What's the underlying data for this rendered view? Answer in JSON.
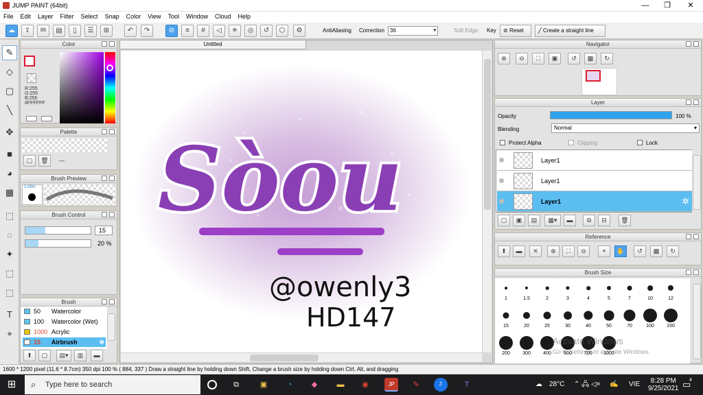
{
  "window": {
    "title": "JUMP PAINT (64bit)",
    "minimize": "—",
    "restore": "❐",
    "close": "✕"
  },
  "menu": [
    "File",
    "Edit",
    "Layer",
    "Filter",
    "Select",
    "Snap",
    "Color",
    "View",
    "Tool",
    "Window",
    "Cloud",
    "Help"
  ],
  "toolbar": {
    "antialiasing_label": "AntiAliasing",
    "correction_label": "Correction",
    "correction_value": "36",
    "softedge_label": "Soft Edge",
    "key_label": "Key",
    "reset_label": "Reset",
    "straight_line_label": "Create a straight line"
  },
  "color_panel": {
    "title": "Color",
    "r": "R:255",
    "g": "G:255",
    "b": "B:255",
    "hex": "#FFFFFF"
  },
  "palette_panel": {
    "title": "Palette",
    "count": "---"
  },
  "brush_preview": {
    "title": "Brush Preview",
    "size": "1.09m"
  },
  "brush_control": {
    "title": "Brush Control",
    "size_value": "15",
    "opacity_value": "20 %",
    "size_fraction": 0.3,
    "opacity_fraction": 0.2
  },
  "brush_panel": {
    "title": "Brush",
    "items": [
      {
        "size": "50",
        "name": "Watercolor",
        "color": "#5bc6ee"
      },
      {
        "size": "100",
        "name": "Watercolor (Wet)",
        "color": "#5bc6ee"
      },
      {
        "size": "1000",
        "name": "Acrylic",
        "color": "#e6c800"
      },
      {
        "size": "15",
        "name": "Airbrush",
        "color": "#f6f6f6"
      }
    ]
  },
  "canvas": {
    "tab_title": "Untitled",
    "artwork_text": "Sòou",
    "handwriting_1": "@owenly3",
    "handwriting_2": "HD147"
  },
  "statusbar": {
    "text": "1600 * 1200 pixel  (11.6 * 8.7cm)  350 dpi  100 %  ( 884, 337 )  Draw a straight line by holding down Shift, Change a brush size by holding down Ctrl, Alt, and dragging"
  },
  "navigator": {
    "title": "Navigator"
  },
  "layer_panel": {
    "title": "Layer",
    "opacity_label": "Opacity",
    "opacity_value": "100 %",
    "opacity_fraction": 1.0,
    "blending_label": "Blending",
    "blending_value": "Normal",
    "protect_alpha": "Protect Alpha",
    "clipping": "Clipping",
    "lock": "Lock",
    "layers": [
      "Layer1",
      "Layer1",
      "Layer1"
    ]
  },
  "reference": {
    "title": "Reference"
  },
  "brush_size": {
    "title": "Brush Size",
    "sizes": [
      "1",
      "1.5",
      "2",
      "3",
      "4",
      "5",
      "7",
      "10",
      "12",
      "15",
      "20",
      "25",
      "30",
      "40",
      "50",
      "70",
      "100",
      "150",
      "200",
      "300",
      "400",
      "500",
      "700",
      "1000"
    ],
    "watermark_1": "Activate Windows",
    "watermark_2": "Go to Settings to activate Windows."
  },
  "taskbar": {
    "search_placeholder": "Type here to search",
    "weather": "28°C",
    "lang": "VIE",
    "time": "8:28 PM",
    "date": "9/25/2021",
    "notif_count": "4"
  },
  "colors": {
    "accent": "#4fa3ec",
    "selected_row": "#5cbdf0",
    "art_purple": "#8a3fb5"
  }
}
